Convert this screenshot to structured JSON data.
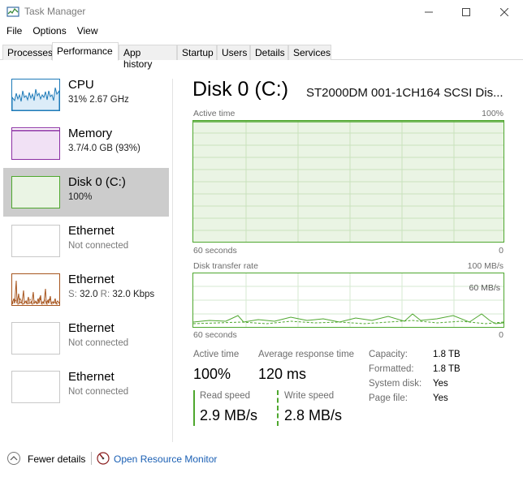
{
  "window": {
    "title": "Task Manager"
  },
  "menu": [
    "File",
    "Options",
    "View"
  ],
  "tabs": [
    {
      "label": "Processes"
    },
    {
      "label": "Performance",
      "active": true
    },
    {
      "label": "App history"
    },
    {
      "label": "Startup"
    },
    {
      "label": "Users"
    },
    {
      "label": "Details"
    },
    {
      "label": "Services"
    }
  ],
  "resources": [
    {
      "name": "CPU",
      "detail": "31%  2.67 GHz",
      "color": "#1d7ab8",
      "thumb": "cpu-graph"
    },
    {
      "name": "Memory",
      "detail": "3.7/4.0 GB (93%)",
      "color": "#8b2ea3",
      "thumb": "memory-graph",
      "fill_fraction": 0.93
    },
    {
      "name": "Disk 0 (C:)",
      "detail": "100%",
      "color": "#4ea72e",
      "selected": true,
      "thumb": "disk-graph"
    },
    {
      "name": "Ethernet",
      "detail": "Not connected",
      "color": "#c8c8c8",
      "thumb": "ethernet-graph"
    },
    {
      "name": "Ethernet",
      "detail_prefix_s": "S:",
      "detail_s_value": "32.0",
      "detail_prefix_r": "R:",
      "detail_r_value": "32.0 Kbps",
      "color": "#a7551e",
      "thumb": "ethernet-graph"
    },
    {
      "name": "Ethernet",
      "detail": "Not connected",
      "color": "#c8c8c8",
      "thumb": "ethernet-graph"
    },
    {
      "name": "Ethernet",
      "detail": "Not connected",
      "color": "#c8c8c8",
      "thumb": "ethernet-graph"
    }
  ],
  "disk": {
    "title": "Disk 0 (C:)",
    "model": "ST2000DM 001-1CH164 SCSI Dis...",
    "active_time_graph": {
      "label": "Active time",
      "max_label": "100%",
      "x_left": "60 seconds",
      "x_right": "0",
      "value_percent": 100
    },
    "transfer_graph": {
      "label": "Disk transfer rate",
      "max_label": "100 MB/s",
      "inner_scale_label": "60 MB/s",
      "x_left": "60 seconds",
      "x_right": "0"
    },
    "stats": {
      "active_time_label": "Active time",
      "active_time_value": "100%",
      "response_label": "Average response time",
      "response_value": "120 ms",
      "read_label": "Read speed",
      "read_value": "2.9 MB/s",
      "write_label": "Write speed",
      "write_value": "2.8 MB/s"
    },
    "properties": [
      {
        "label": "Capacity:",
        "value": "1.8 TB"
      },
      {
        "label": "Formatted:",
        "value": "1.8 TB"
      },
      {
        "label": "System disk:",
        "value": "Yes"
      },
      {
        "label": "Page file:",
        "value": "Yes"
      }
    ]
  },
  "footer": {
    "fewer_details": "Fewer details",
    "resource_monitor": "Open Resource Monitor"
  },
  "colors": {
    "disk_line": "#4ea72e",
    "disk_fill": "#eaf4e4",
    "disk_grid": "#c9e2bd",
    "link": "#1a5fb4"
  }
}
